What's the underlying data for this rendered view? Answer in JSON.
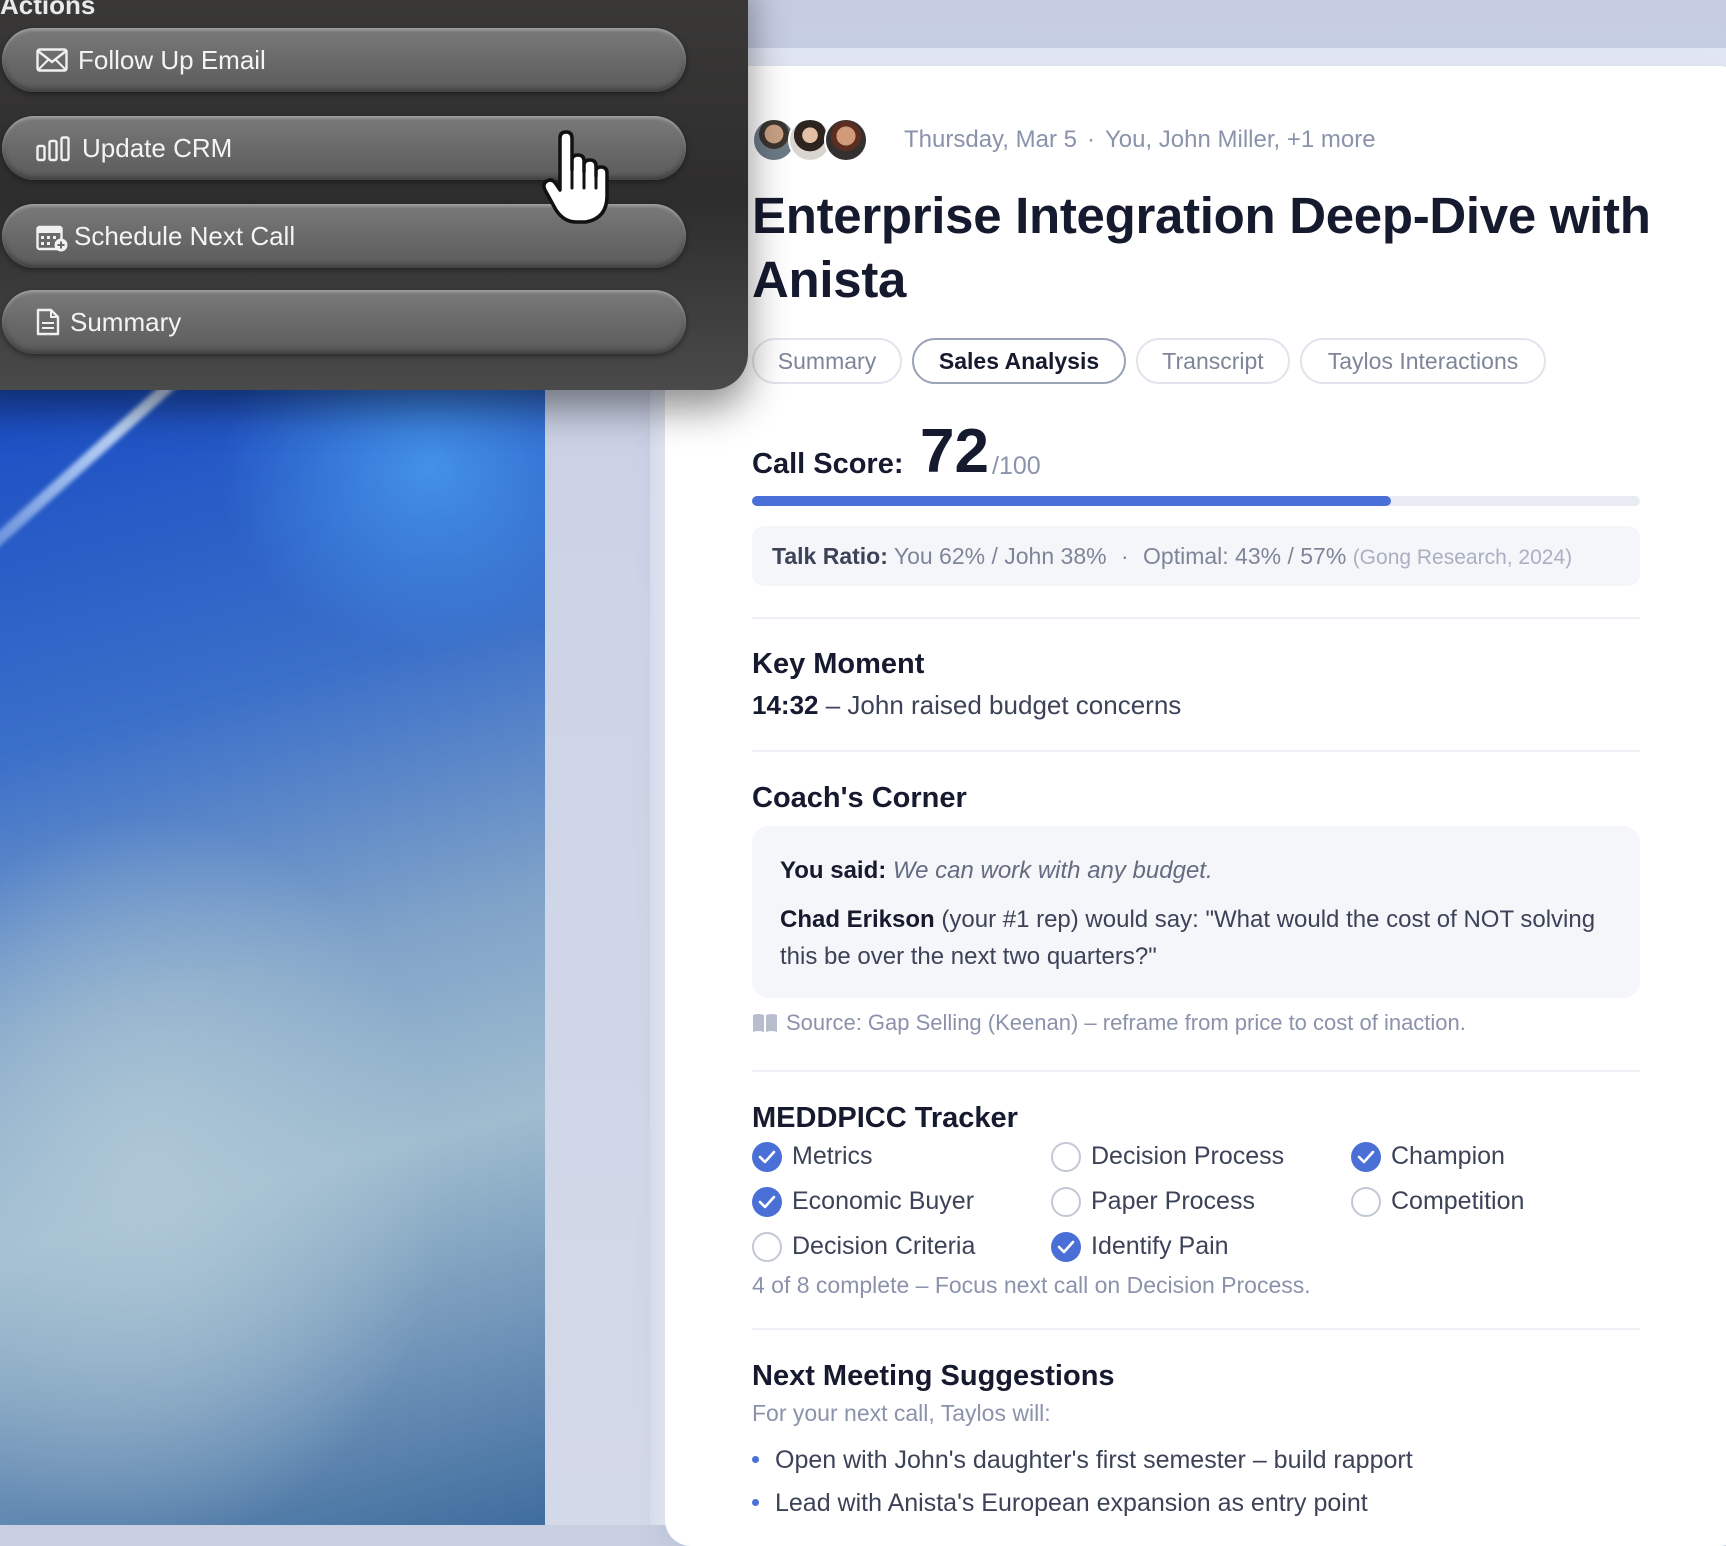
{
  "actions": {
    "heading": "Actions",
    "buttons": [
      {
        "label": "Follow Up Email",
        "icon": "mail-icon"
      },
      {
        "label": "Update CRM",
        "icon": "bar-chart-icon"
      },
      {
        "label": "Schedule Next Call",
        "icon": "calendar-add-icon"
      },
      {
        "label": "Summary",
        "icon": "document-icon"
      }
    ]
  },
  "meeting": {
    "date": "Thursday, Mar 5",
    "separator": "·",
    "participants": "You, John Miller, +1 more",
    "title": "Enterprise Integration Deep-Dive with Anista"
  },
  "tabs": [
    {
      "label": "Summary",
      "active": false
    },
    {
      "label": "Sales Analysis",
      "active": true
    },
    {
      "label": "Transcript",
      "active": false
    },
    {
      "label": "Taylos Interactions",
      "active": false
    }
  ],
  "score": {
    "label": "Call Score:",
    "value": "72",
    "max": "/100",
    "fraction": 0.72
  },
  "talk_ratio": {
    "label": "Talk Ratio:",
    "value": "You 62% / John 38%",
    "separator": "·",
    "optimal": "Optimal: 43% / 57%",
    "source": "(Gong Research, 2024)"
  },
  "key_moment": {
    "title": "Key Moment",
    "time": "14:32",
    "text": "– John raised budget concerns"
  },
  "coach": {
    "title": "Coach's Corner",
    "said_label": "You said:",
    "said_text": "We can work with any budget.",
    "rep_name": "Chad Erikson",
    "rep_text": "(your #1 rep) would say: \"What would the cost of NOT solving this be over the next two quarters?\"",
    "source": "Source: Gap Selling (Keenan) – reframe from price to cost of inaction."
  },
  "meddpicc": {
    "title": "MEDDPICC Tracker",
    "items": [
      {
        "label": "Metrics",
        "checked": true
      },
      {
        "label": "Decision Process",
        "checked": false
      },
      {
        "label": "Champion",
        "checked": true
      },
      {
        "label": "Economic Buyer",
        "checked": true
      },
      {
        "label": "Paper Process",
        "checked": false
      },
      {
        "label": "Competition",
        "checked": false
      },
      {
        "label": "Decision Criteria",
        "checked": false
      },
      {
        "label": "Identify Pain",
        "checked": true
      }
    ],
    "summary": "4 of 8 complete – Focus next call on Decision Process."
  },
  "next_meeting": {
    "title": "Next Meeting Suggestions",
    "subtitle": "For your next call, Taylos will:",
    "bullets": [
      "Open with John's daughter's first semester – build rapport",
      "Lead with Anista's European expansion as entry point"
    ]
  },
  "colors": {
    "accent": "#4a6fd6",
    "text": "#161a2e",
    "muted": "#8a93ab"
  }
}
